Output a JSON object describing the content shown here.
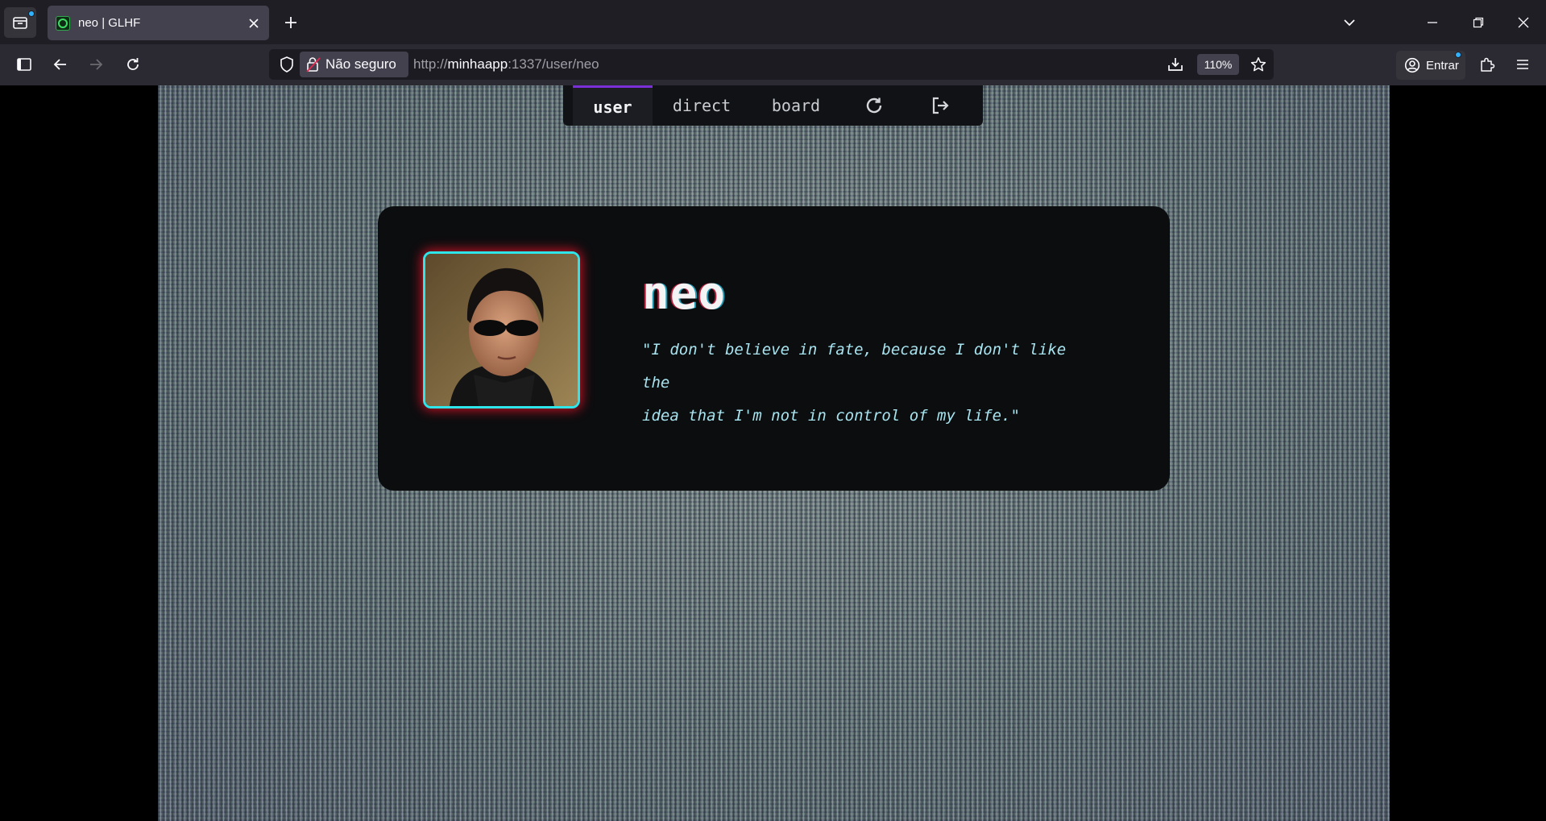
{
  "browser": {
    "tab": {
      "title": "neo | GLHF"
    },
    "address": {
      "security_label": "Não seguro",
      "url_scheme": "http://",
      "url_host": "minhaapp",
      "url_rest": ":1337/user/neo",
      "zoom": "110%"
    },
    "account": {
      "signin_label": "Entrar"
    }
  },
  "app": {
    "nav": {
      "items": [
        {
          "label": "user",
          "active": true
        },
        {
          "label": "direct",
          "active": false
        },
        {
          "label": "board",
          "active": false
        }
      ],
      "icons": [
        "refresh-icon",
        "logout-icon"
      ]
    },
    "profile": {
      "username": "neo",
      "quote_line1": "\"I don't believe in fate, because I don't like the",
      "quote_line2": "idea that I'm not in control of my life.\"",
      "avatar_icon": "avatar-portrait"
    },
    "colors": {
      "nav_active_border": "#7b2fd6",
      "avatar_border": "#2ee6ea",
      "avatar_glow": "#e6142a",
      "quote_text": "#a8e4f0"
    }
  }
}
